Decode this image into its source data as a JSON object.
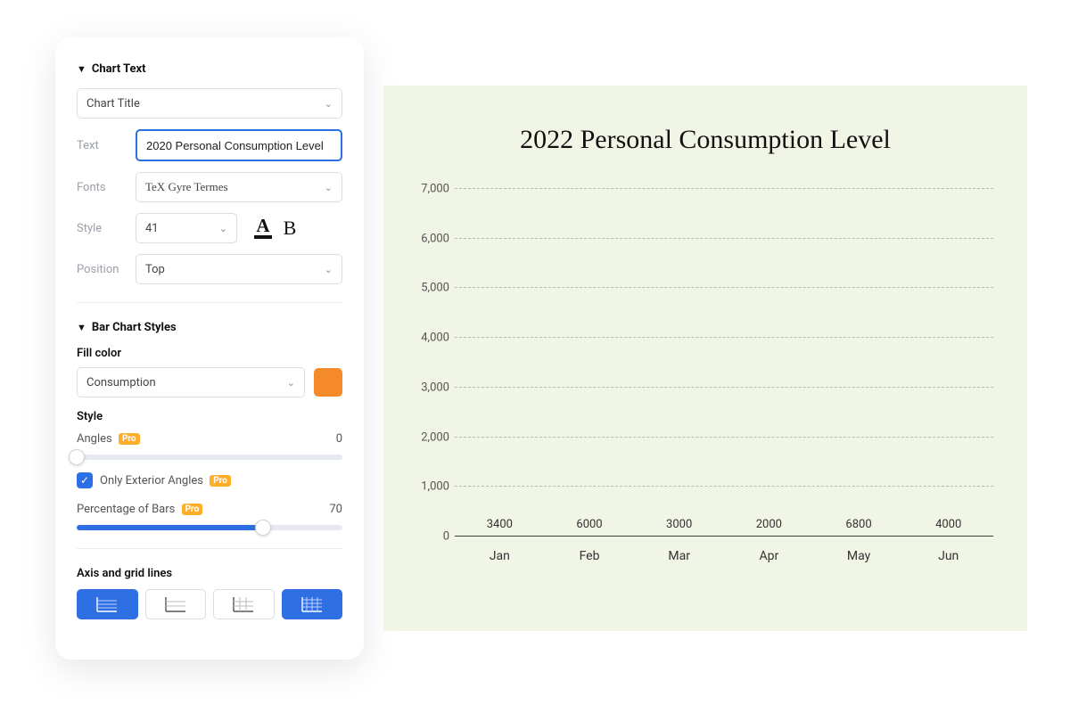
{
  "panel": {
    "chart_text": {
      "header": "Chart Text",
      "target_select": "Chart Title",
      "text_label": "Text",
      "text_value": "2020 Personal Consumption Level",
      "fonts_label": "Fonts",
      "fonts_value": "TeX Gyre Termes",
      "style_label": "Style",
      "size_value": "41",
      "position_label": "Position",
      "position_value": "Top"
    },
    "bar_styles": {
      "header": "Bar Chart Styles",
      "fill_color_label": "Fill color",
      "series_select": "Consumption",
      "swatch_color": "#f58a2a",
      "style_label": "Style",
      "angles_label": "Angles",
      "angles_value": "0",
      "only_exterior_label": "Only Exterior Angles",
      "percent_bars_label": "Percentage of Bars",
      "percent_bars_value": "70",
      "pro_badge": "Pro"
    },
    "axis": {
      "header": "Axis and grid lines"
    }
  },
  "chart_data": {
    "type": "bar",
    "title": "2022 Personal Consumption Level",
    "categories": [
      "Jan",
      "Feb",
      "Mar",
      "Apr",
      "May",
      "Jun"
    ],
    "values": [
      3400,
      6000,
      3000,
      2000,
      6800,
      4000
    ],
    "y_ticks": [
      0,
      1000,
      2000,
      3000,
      4000,
      5000,
      6000,
      7000
    ],
    "y_tick_labels": [
      "0",
      "1,000",
      "2,000",
      "3,000",
      "4,000",
      "5,000",
      "6,000",
      "7,000"
    ],
    "ylim": [
      0,
      7000
    ],
    "bar_color": "#f58a2a",
    "xlabel": "",
    "ylabel": ""
  }
}
